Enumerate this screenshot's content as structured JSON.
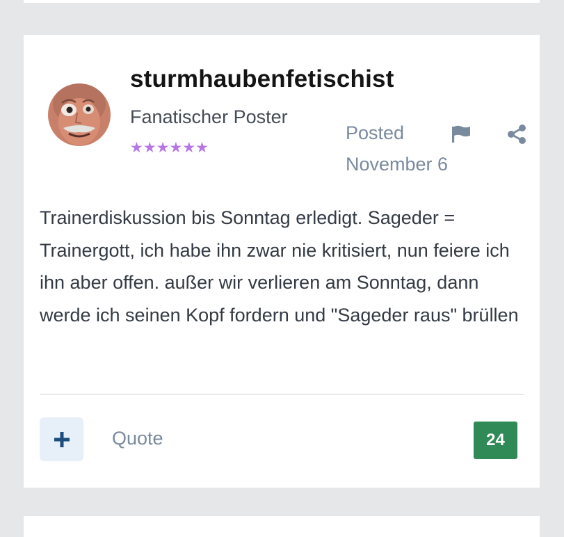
{
  "post": {
    "author": {
      "username": "sturmhaubenfetischist",
      "rank": "Fanatischer Poster",
      "stars": [
        "★",
        "★",
        "★",
        "★",
        "★",
        "★"
      ]
    },
    "posted_label": "Posted",
    "posted_date": "November 6",
    "body": "Trainerdiskussion bis Sonntag erledigt. Sageder = Trainergott, ich habe ihn zwar nie kritisiert, nun feiere ich ihn aber offen. außer wir verlieren am Sonntag, dann werde ich seinen Kopf fordern und \"Sageder raus\" brüllen",
    "actions": {
      "quote_label": "Quote",
      "reputation": "24"
    }
  },
  "icons": {
    "report": "flag-icon",
    "share": "share-icon",
    "add_reaction": "plus-icon"
  },
  "colors": {
    "star": "#b676e6",
    "reputation_badge": "#2f8a57",
    "muted_text": "#7a8a9e",
    "add_button_bg": "#e7f0f8",
    "add_button_icon": "#1b4e7e"
  }
}
